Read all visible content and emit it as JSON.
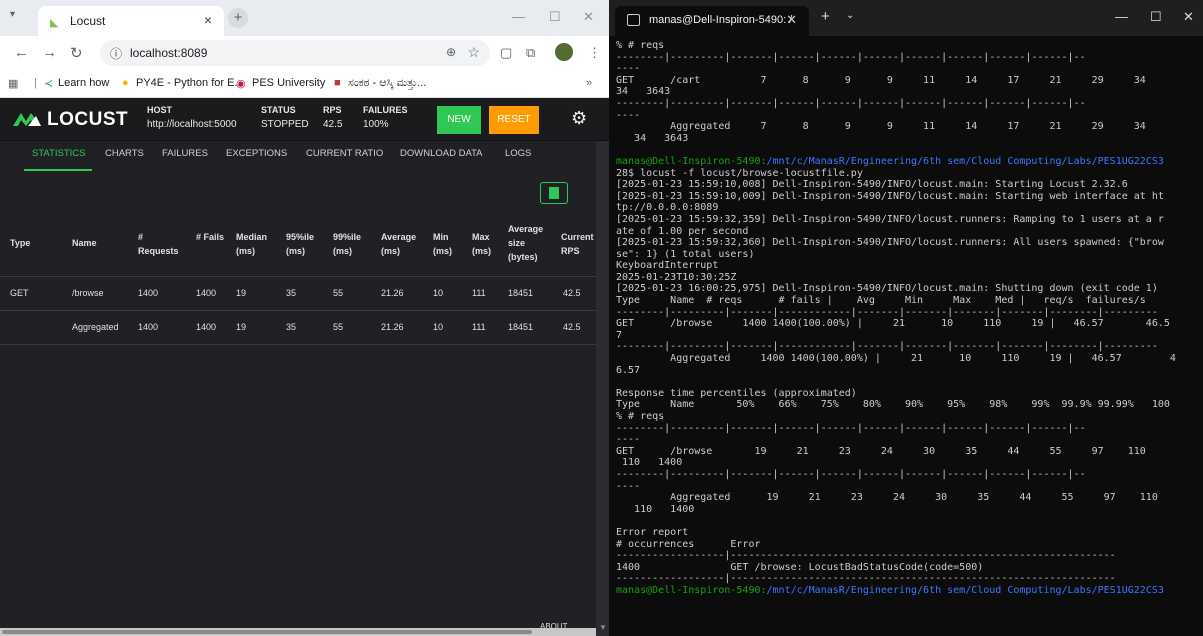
{
  "browser": {
    "tab_title": "Locust",
    "url": "localhost:8089",
    "bookmarks": [
      "Learn how",
      "PY4E - Python for E...",
      "PES University",
      "ಸಂಕಠ - ಆಸ್ಕಿ ಮತ್ತು..."
    ],
    "window_controls": [
      "—",
      "☐",
      "✕"
    ]
  },
  "locust": {
    "brand": "LOCUST",
    "host_label": "HOST",
    "host_value": "http://localhost:5000",
    "status_label": "STATUS",
    "status_value": "STOPPED",
    "rps_label": "RPS",
    "rps_value": "42.5",
    "failures_label": "FAILURES",
    "failures_value": "100%",
    "new_button": "NEW",
    "reset_button": "RESET",
    "tabs": [
      "STATISTICS",
      "CHARTS",
      "FAILURES",
      "EXCEPTIONS",
      "CURRENT RATIO",
      "DOWNLOAD DATA",
      "LOGS"
    ],
    "active_tab": "STATISTICS",
    "about": "ABOUT",
    "columns": [
      "Type",
      "Name",
      "# Requests",
      "# Fails",
      "Median (ms)",
      "95%ile (ms)",
      "99%ile (ms)",
      "Average (ms)",
      "Min (ms)",
      "Max (ms)",
      "Average size (bytes)",
      "Current RPS"
    ],
    "rows": [
      [
        "GET",
        "/browse",
        "1400",
        "1400",
        "19",
        "35",
        "55",
        "21.26",
        "10",
        "111",
        "18451",
        "42.5"
      ],
      [
        "",
        "Aggregated",
        "1400",
        "1400",
        "19",
        "35",
        "55",
        "21.26",
        "10",
        "111",
        "18451",
        "42.5"
      ]
    ]
  },
  "terminal": {
    "tab_title": "manas@Dell-Inspiron-5490: /",
    "lines": [
      "% # reqs",
      "--------|---------|-------|------|------|------|------|------|------|------|--",
      "----",
      "GET      /cart          7      8      9      9     11     14     17     21     29     34",
      "34   3643",
      "--------|---------|-------|------|------|------|------|------|------|------|--",
      "----",
      "         Aggregated     7      8      9      9     11     14     17     21     29     34",
      "   34   3643",
      "",
      "manas@Dell-Inspiron-5490:/mnt/c/ManasR/Engineering/6th sem/Cloud Computing/Labs/PES1UG22CS3",
      "28$ locust -f locust/browse-locustfile.py",
      "[2025-01-23 15:59:10,008] Dell-Inspiron-5490/INFO/locust.main: Starting Locust 2.32.6",
      "[2025-01-23 15:59:10,009] Dell-Inspiron-5490/INFO/locust.main: Starting web interface at ht",
      "tp://0.0.0.0:8089",
      "[2025-01-23 15:59:32,359] Dell-Inspiron-5490/INFO/locust.runners: Ramping to 1 users at a r",
      "ate of 1.00 per second",
      "[2025-01-23 15:59:32,360] Dell-Inspiron-5490/INFO/locust.runners: All users spawned: {\"brow",
      "se\": 1} (1 total users)",
      "KeyboardInterrupt",
      "2025-01-23T10:30:25Z",
      "[2025-01-23 16:00:25,975] Dell-Inspiron-5490/INFO/locust.main: Shutting down (exit code 1)",
      "Type     Name  # reqs      # fails |    Avg     Min     Max    Med |   req/s  failures/s",
      "--------|---------|-------|------------|-------|-------|-------|-------|--------|---------",
      "GET      /browse     1400 1400(100.00%) |     21      10     110     19 |   46.57       46.5",
      "7",
      "--------|---------|-------|------------|-------|-------|-------|-------|--------|---------",
      "         Aggregated     1400 1400(100.00%) |     21      10     110     19 |   46.57        4",
      "6.57",
      "",
      "Response time percentiles (approximated)",
      "Type     Name       50%    66%    75%    80%    90%    95%    98%    99%  99.9% 99.99%   100",
      "% # reqs",
      "--------|---------|-------|------|------|------|------|------|------|------|--",
      "----",
      "GET      /browse       19     21     23     24     30     35     44     55     97    110",
      " 110   1400",
      "--------|---------|-------|------|------|------|------|------|------|------|--",
      "----",
      "         Aggregated      19     21     23     24     30     35     44     55     97    110",
      "   110   1400",
      "",
      "Error report",
      "# occurrences      Error",
      "------------------|----------------------------------------------------------------",
      "1400               GET /browse: LocustBadStatusCode(code=500)",
      "------------------|----------------------------------------------------------------",
      "manas@Dell-Inspiron-5490:/mnt/c/ManasR/Engineering/6th sem/Cloud Computing/Labs/PES1UG22CS3"
    ]
  },
  "colors": {
    "locust_green": "#2fc855",
    "reset_orange": "#ff9d00",
    "prompt_green": "#13a10e",
    "path_blue": "#3b78ff"
  }
}
